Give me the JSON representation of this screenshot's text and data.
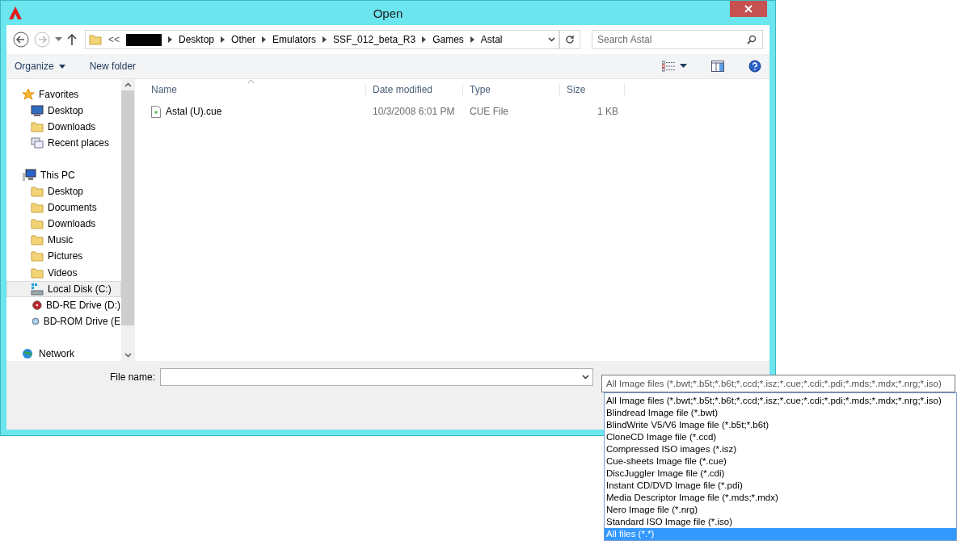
{
  "window": {
    "title": "Open"
  },
  "address": {
    "items": [
      {
        "kind": "overflow",
        "label": "<<"
      },
      {
        "kind": "redacted"
      },
      {
        "kind": "folder",
        "label": "Desktop"
      },
      {
        "kind": "folder",
        "label": "Other"
      },
      {
        "kind": "folder",
        "label": "Emulators"
      },
      {
        "kind": "folder",
        "label": "SSF_012_beta_R3"
      },
      {
        "kind": "folder",
        "label": "Games"
      },
      {
        "kind": "folder",
        "label": "Astal"
      }
    ]
  },
  "search": {
    "placeholder": "Search Astal"
  },
  "toolbar": {
    "buttons": [
      "Organize",
      "New folder"
    ]
  },
  "sidebar": {
    "groups": [
      {
        "label": "Favorites",
        "children": [
          {
            "label": "Desktop",
            "selected": false
          },
          {
            "label": "Downloads",
            "selected": false
          },
          {
            "label": "Recent places",
            "selected": false
          }
        ]
      },
      {
        "label": "This PC",
        "children": [
          {
            "label": "Desktop",
            "selected": false
          },
          {
            "label": "Documents",
            "selected": false
          },
          {
            "label": "Downloads",
            "selected": false
          },
          {
            "label": "Music",
            "selected": false
          },
          {
            "label": "Pictures",
            "selected": false
          },
          {
            "label": "Videos",
            "selected": false
          },
          {
            "label": "Local Disk (C:)",
            "selected": true
          },
          {
            "label": "BD-RE Drive (D:)",
            "selected": false
          },
          {
            "label": "BD-ROM Drive (E",
            "selected": false
          }
        ]
      },
      {
        "label": "Network"
      }
    ]
  },
  "table": {
    "columns": [
      "Name",
      "Date modified",
      "Type",
      "Size"
    ],
    "rows": [
      {
        "name": "Astal (U).cue",
        "date": "10/3/2008 6:01 PM",
        "type": "CUE File",
        "size": "1 KB"
      }
    ]
  },
  "footer": {
    "file_name_label": "File name:",
    "file_type": "All Image files (*.bwt;*.b5t;*.b6t;*.ccd;*.isz;*.cue;*.cdi;*.pdi;*.mds;*.mdx;*.nrg;*.iso)",
    "options": [
      {
        "label": "All Image files (*.bwt;*.b5t;*.b6t;*.ccd;*.isz;*.cue;*.cdi;*.pdi;*.mds;*.mdx;*.nrg;*.iso)",
        "selected": false
      },
      {
        "label": "Blindread Image file (*.bwt)",
        "selected": false
      },
      {
        "label": "BlindWrite V5/V6 Image file (*.b5t;*.b6t)",
        "selected": false
      },
      {
        "label": "CloneCD Image file (*.ccd)",
        "selected": false
      },
      {
        "label": "Compressed ISO images (*.isz)",
        "selected": false
      },
      {
        "label": "Cue-sheets Image file (*.cue)",
        "selected": false
      },
      {
        "label": "DiscJuggler Image file (*.cdi)",
        "selected": false
      },
      {
        "label": "Instant CD/DVD Image file (*.pdi)",
        "selected": false
      },
      {
        "label": "Media Descriptor Image file (*.mds;*.mdx)",
        "selected": false
      },
      {
        "label": "Nero Image file (*.nrg)",
        "selected": false
      },
      {
        "label": "Standard ISO Image file (*.iso)",
        "selected": false
      },
      {
        "label": "All files (*.*)",
        "selected": true
      }
    ]
  }
}
